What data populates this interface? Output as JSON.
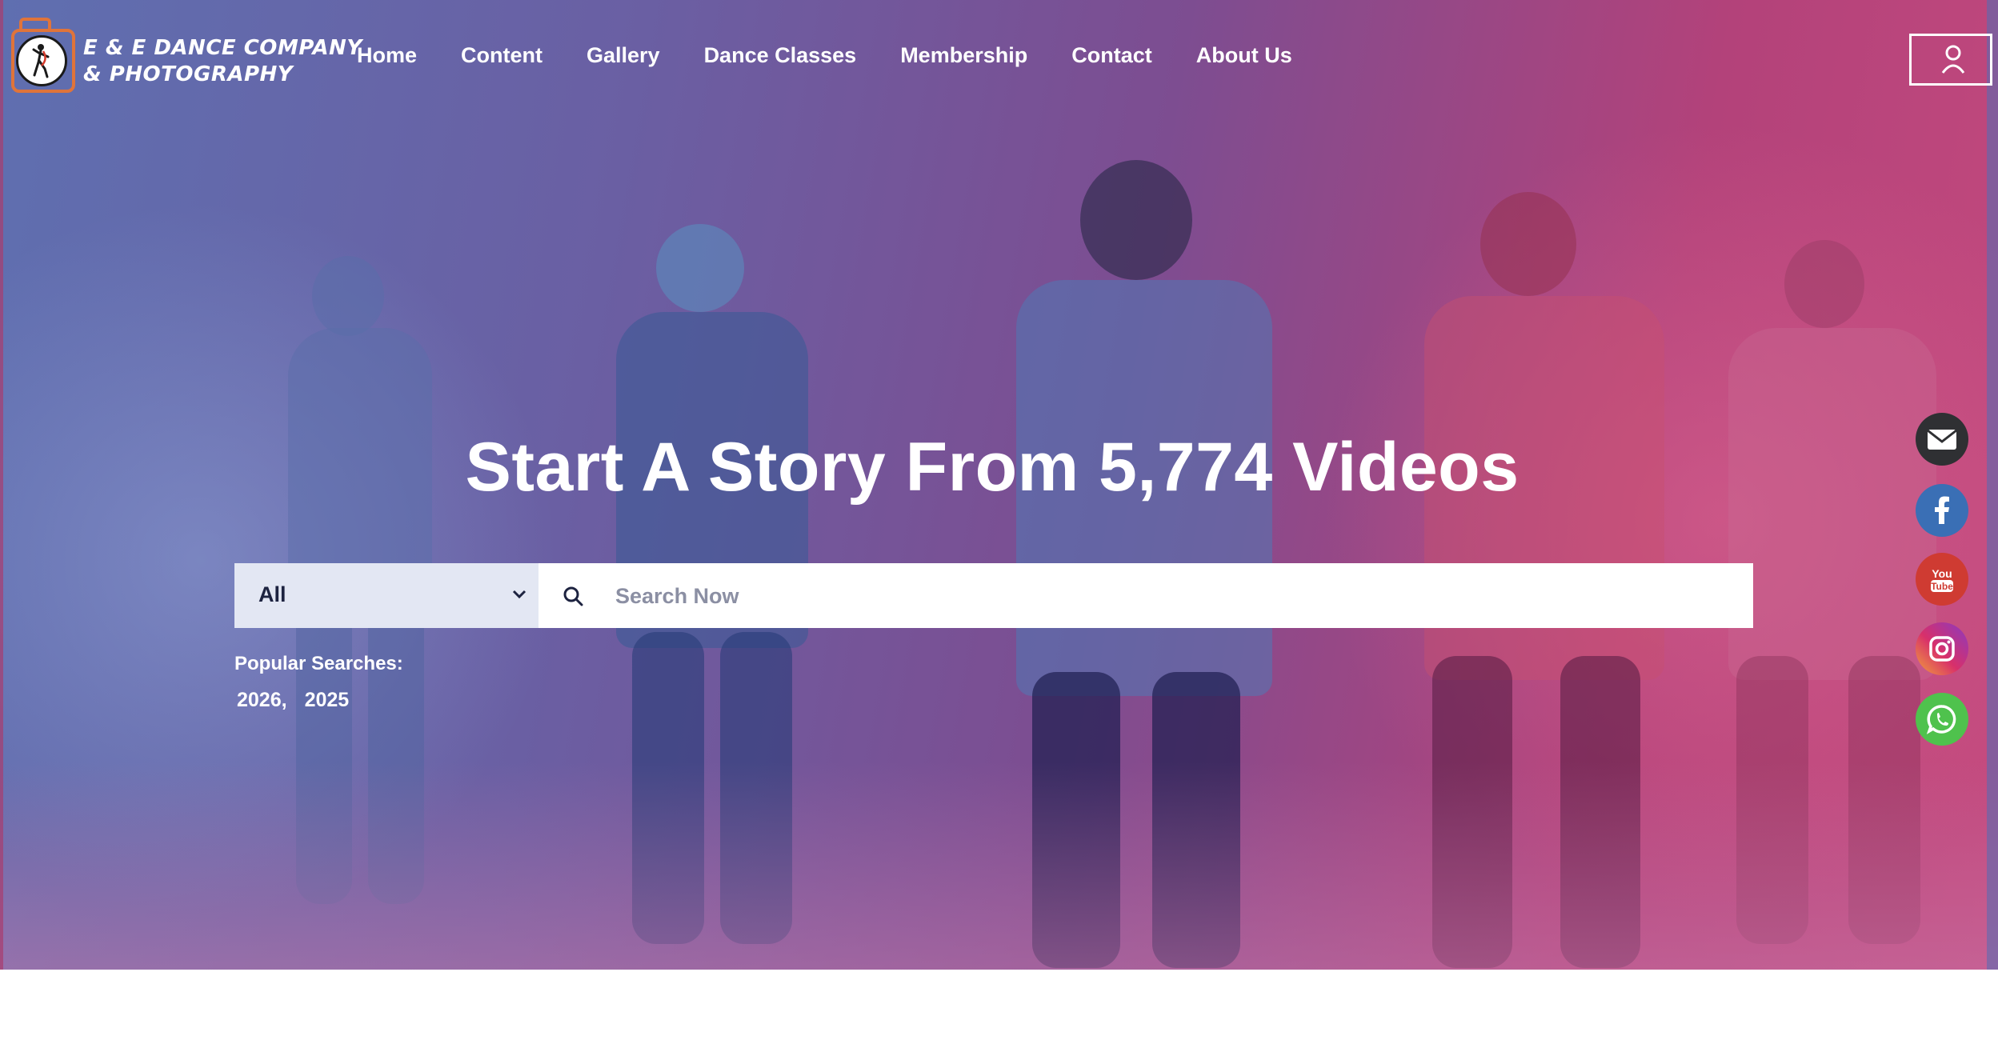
{
  "brand": {
    "line1": "E & E DANCE COMPANY",
    "line2": "& PHOTOGRAPHY"
  },
  "nav": {
    "items": [
      "Home",
      "Content",
      "Gallery",
      "Dance Classes",
      "Membership",
      "Contact",
      "About Us"
    ]
  },
  "hero": {
    "headline": "Start A Story From 5,774 Videos"
  },
  "search": {
    "category_selected": "All",
    "placeholder": "Search Now"
  },
  "popular": {
    "title": "Popular Searches:",
    "tags": [
      "2026,",
      "2025"
    ]
  },
  "social": {
    "icons": [
      "email-icon",
      "facebook-icon",
      "youtube-icon",
      "instagram-icon",
      "whatsapp-icon"
    ],
    "colors": [
      "#2f3033",
      "#3a6fb5",
      "#cf3b32",
      "#b83a9c",
      "#4fc24d"
    ]
  },
  "colors": {
    "accent": "#e0743a",
    "overlay_left": "#5f6fb0",
    "overlay_right": "#c44a7e"
  }
}
